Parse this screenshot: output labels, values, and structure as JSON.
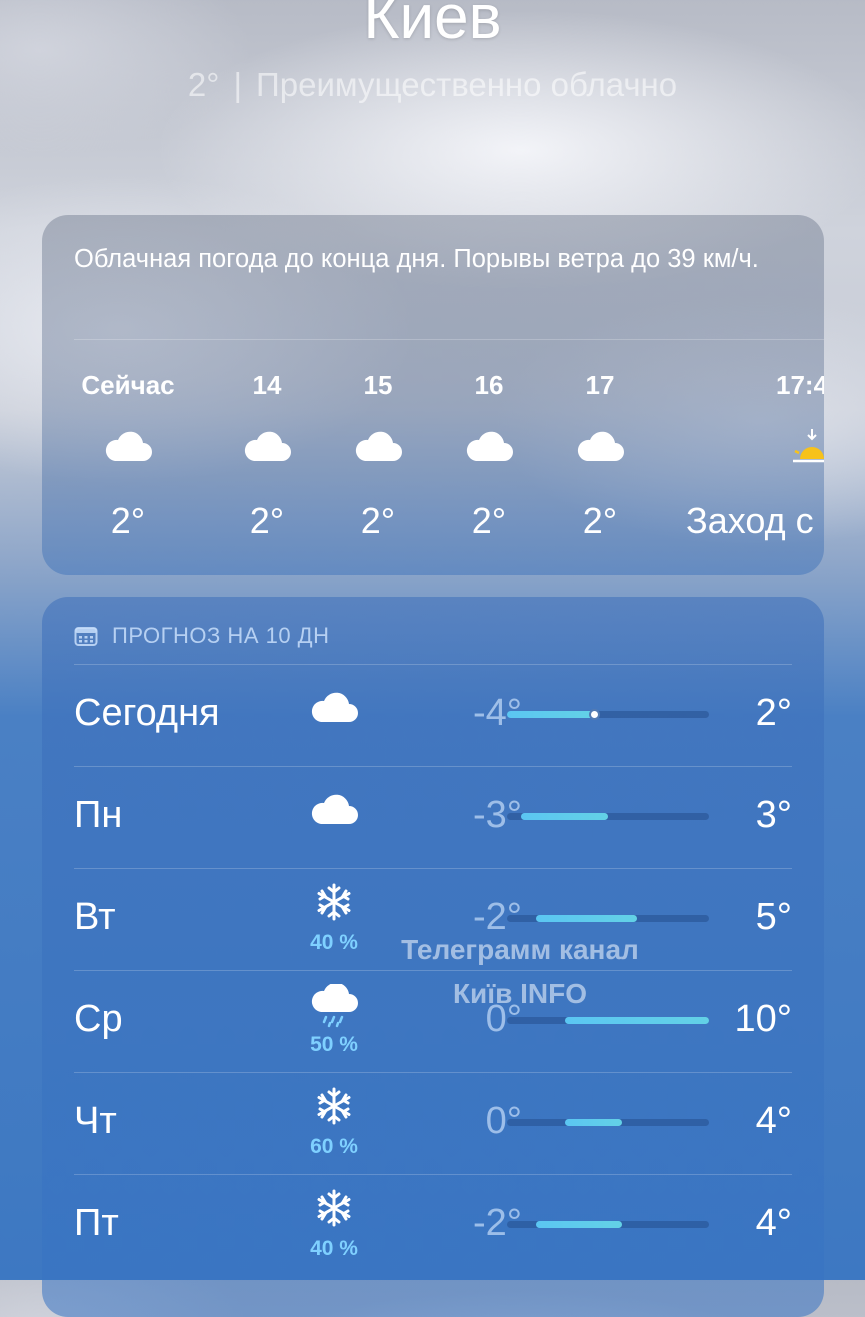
{
  "header": {
    "city": "Киев",
    "temp": "2°",
    "condition": "Преимущественно облачно"
  },
  "hourly": {
    "summary": "Облачная погода до конца дня. Порывы ветра до 39 км/ч.",
    "items": [
      {
        "label": "Сейчас",
        "icon": "cloud-icon",
        "temp": "2°"
      },
      {
        "label": "14",
        "icon": "cloud-icon",
        "temp": "2°"
      },
      {
        "label": "15",
        "icon": "cloud-icon",
        "temp": "2°"
      },
      {
        "label": "16",
        "icon": "cloud-icon",
        "temp": "2°"
      },
      {
        "label": "17",
        "icon": "cloud-icon",
        "temp": "2°"
      },
      {
        "label": "17:4",
        "icon": "sunset-icon",
        "temp": "Заход с"
      }
    ]
  },
  "daily": {
    "title": "ПРОГНОЗ НА 10 ДН",
    "range": {
      "min": -4,
      "max": 10
    },
    "days": [
      {
        "day": "Сегодня",
        "icon": "cloud-icon",
        "precip": "",
        "low": "-4°",
        "high": "2°",
        "low_val": -4,
        "high_val": 2,
        "current": 2
      },
      {
        "day": "Пн",
        "icon": "cloud-icon",
        "precip": "",
        "low": "-3°",
        "high": "3°",
        "low_val": -3,
        "high_val": 3
      },
      {
        "day": "Вт",
        "icon": "snowflake-icon",
        "precip": "40 %",
        "low": "-2°",
        "high": "5°",
        "low_val": -2,
        "high_val": 5
      },
      {
        "day": "Ср",
        "icon": "rain-cloud-icon",
        "precip": "50 %",
        "low": "0°",
        "high": "10°",
        "low_val": 0,
        "high_val": 10
      },
      {
        "day": "Чт",
        "icon": "snowflake-icon",
        "precip": "60 %",
        "low": "0°",
        "high": "4°",
        "low_val": 0,
        "high_val": 4
      },
      {
        "day": "Пт",
        "icon": "snowflake-icon",
        "precip": "40 %",
        "low": "-2°",
        "high": "4°",
        "low_val": -2,
        "high_val": 4
      }
    ]
  },
  "watermark": {
    "line1": "Телеграмм канал",
    "line2": "Київ INFO"
  }
}
